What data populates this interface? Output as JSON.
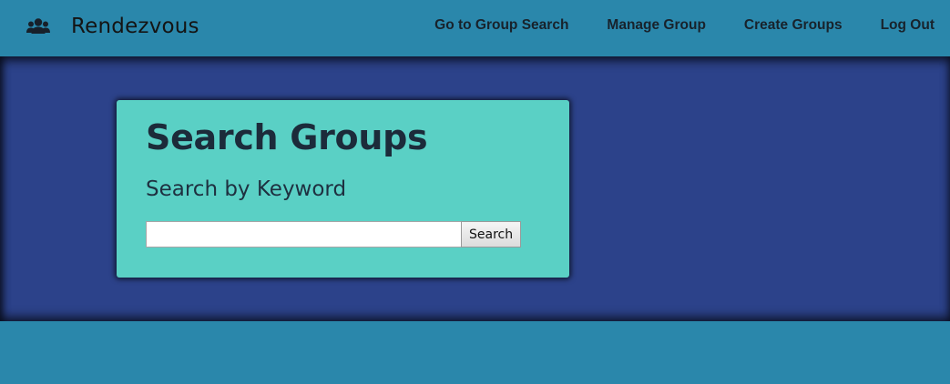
{
  "colors": {
    "navbar_bg": "#2a87ab",
    "hero_bg": "#2c428a",
    "card_bg": "#5ad0c5",
    "text_dark": "#1c2b3a"
  },
  "navbar": {
    "brand_icon": "users-icon",
    "brand_title": "Rendezvous",
    "links": [
      {
        "label": "Go to Group Search"
      },
      {
        "label": "Manage Group"
      },
      {
        "label": "Create Groups"
      },
      {
        "label": "Log Out"
      }
    ]
  },
  "search_card": {
    "title": "Search Groups",
    "subtitle": "Search by Keyword",
    "input_value": "",
    "input_placeholder": "",
    "button_label": "Search"
  }
}
